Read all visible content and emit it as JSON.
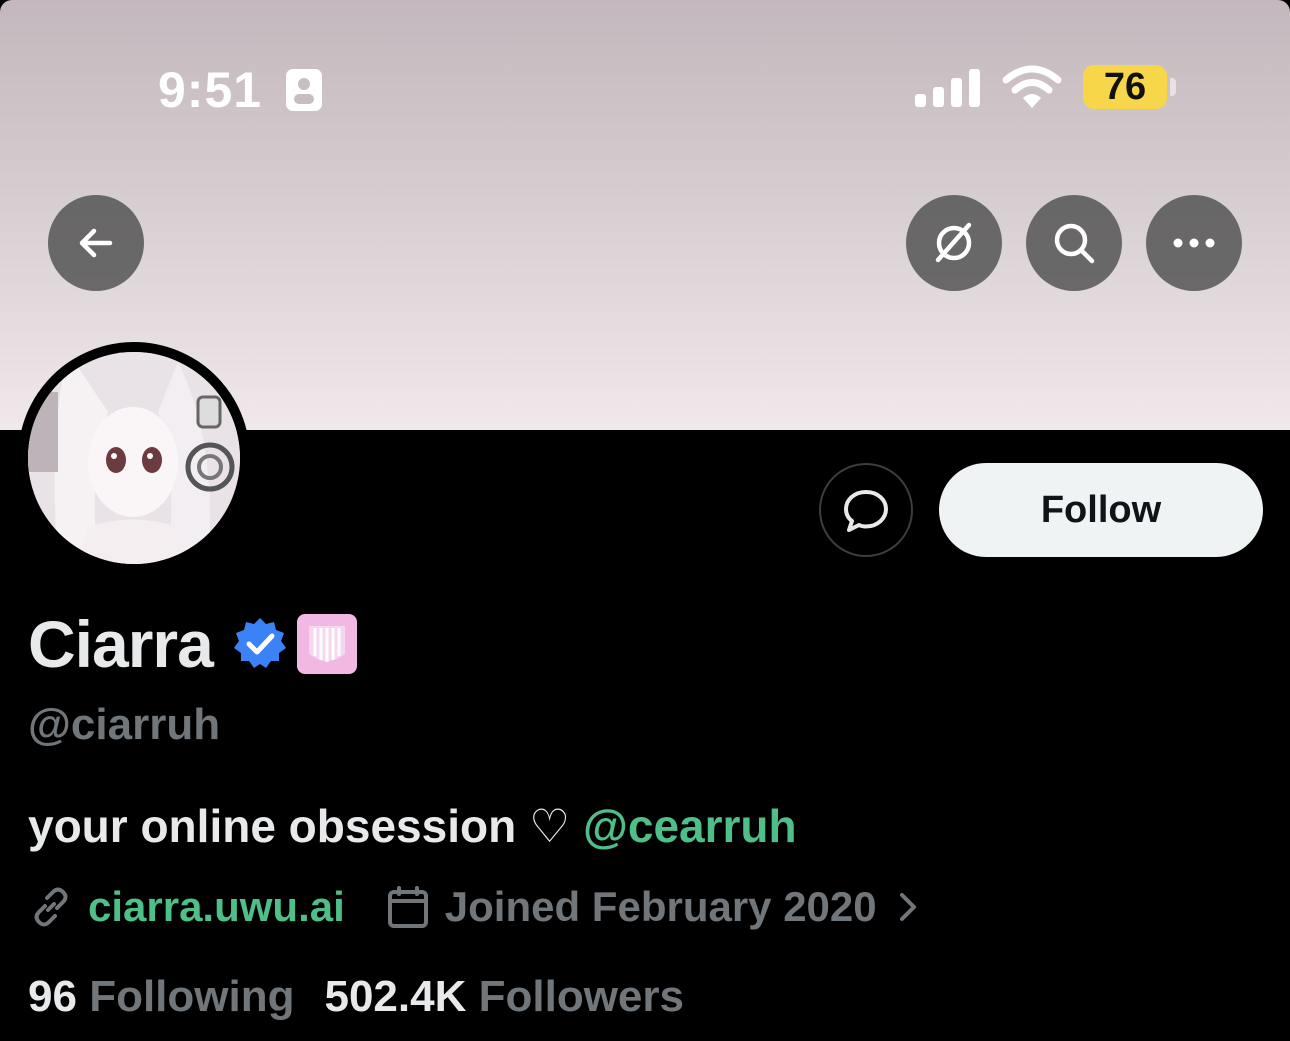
{
  "status_bar": {
    "time": "9:51",
    "battery": "76",
    "battery_color": "#f7d64a"
  },
  "header": {
    "icons": [
      "back-arrow-icon",
      "grok-icon",
      "search-icon",
      "more-icon"
    ]
  },
  "profile": {
    "display_name": "Ciarra",
    "handle": "@ciarruh",
    "bio_text": "your online obsession ♡ ",
    "bio_mention": "@cearruh",
    "website": "ciarra.uwu.ai",
    "joined": "Joined February 2020",
    "following_count": "96",
    "following_label": "Following",
    "followers_count": "502.4K",
    "followers_label": "Followers",
    "verified_badge_color": "#3b82f6",
    "affiliate_badge_color": "#f0b8e2"
  },
  "actions": {
    "follow_label": "Follow"
  },
  "colors": {
    "background": "#000000",
    "text_primary": "#e7e9ea",
    "text_secondary": "#71767b",
    "link": "#4fbf8a"
  }
}
